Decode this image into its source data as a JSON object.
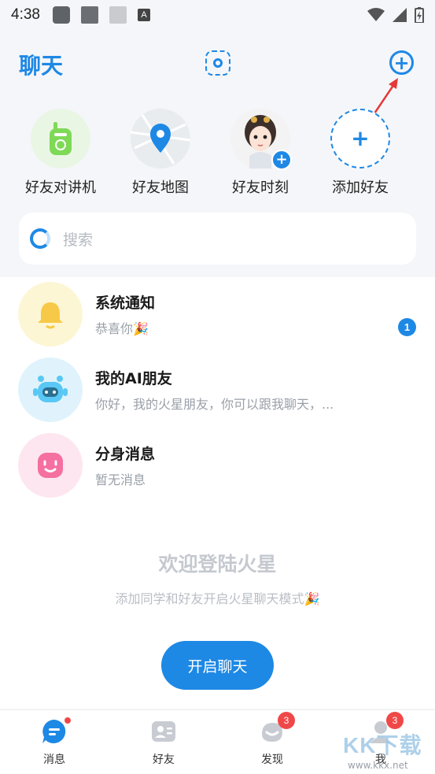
{
  "status_bar": {
    "time": "4:38"
  },
  "header": {
    "title": "聊天"
  },
  "quick_actions": [
    {
      "label": "好友对讲机",
      "icon": "walkie-talkie-icon"
    },
    {
      "label": "好友地图",
      "icon": "map-pin-icon"
    },
    {
      "label": "好友时刻",
      "icon": "avatar-moment-icon"
    },
    {
      "label": "添加好友",
      "icon": "plus-icon"
    }
  ],
  "search": {
    "placeholder": "搜索"
  },
  "messages": [
    {
      "title": "系统通知",
      "subtitle": "恭喜你🎉",
      "badge": "1",
      "icon": "bell-icon"
    },
    {
      "title": "我的AI朋友",
      "subtitle": "你好，我的火星朋友，你可以跟我聊天，...",
      "icon": "robot-icon"
    },
    {
      "title": "分身消息",
      "subtitle": "暂无消息",
      "icon": "smile-icon"
    }
  ],
  "welcome": {
    "title": "欢迎登陆火星",
    "subtitle": "添加同学和好友开启火星聊天模式🎉",
    "button": "开启聊天"
  },
  "bottom_nav": [
    {
      "label": "消息",
      "icon": "chat-icon",
      "dot": true
    },
    {
      "label": "好友",
      "icon": "contacts-icon"
    },
    {
      "label": "发现",
      "icon": "discover-icon",
      "badge": "3"
    },
    {
      "label": "我",
      "icon": "profile-icon",
      "badge": "3"
    }
  ],
  "watermark": {
    "text": "KK下载",
    "url_text": "www.kkx.net"
  },
  "colors": {
    "accent": "#1e88e5",
    "badge_red": "#f04848"
  }
}
